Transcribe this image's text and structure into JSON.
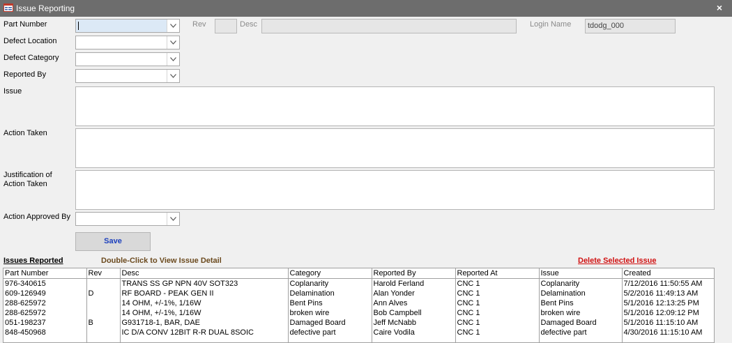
{
  "window": {
    "title": "Issue Reporting",
    "close_glyph": "×",
    "icon": "form-icon"
  },
  "fields": {
    "part_number_label": "Part Number",
    "rev_label": "Rev",
    "rev_value": "",
    "desc_label": "Desc",
    "desc_value": "",
    "login_name_label": "Login Name",
    "login_name_value": "tdodg_000",
    "defect_location_label": "Defect Location",
    "defect_category_label": "Defect Category",
    "reported_by_label": "Reported By",
    "issue_label": "Issue",
    "action_taken_label": "Action Taken",
    "justification_label_line1": "Justification of",
    "justification_label_line2": "Action Taken",
    "action_approved_by_label": "Action Approved By"
  },
  "buttons": {
    "save_label": "Save"
  },
  "issues_section": {
    "title": "Issues Reported",
    "hint": "Double-Click to View Issue Detail",
    "delete_label": "Delete Selected Issue"
  },
  "grid": {
    "columns": [
      "Part Number",
      "Rev",
      "Desc",
      "Category",
      "Reported By",
      "Reported At",
      "Issue",
      "Created"
    ],
    "rows": [
      [
        "976-340615",
        "",
        "TRANS SS GP NPN 40V SOT323",
        "Coplanarity",
        "Harold Ferland",
        "CNC 1",
        "Coplanarity",
        "7/12/2016 11:50:55 AM"
      ],
      [
        "609-126949",
        "D",
        "RF BOARD - PEAK GEN II",
        "Delamination",
        "Alan Yonder",
        "CNC 1",
        "Delamination",
        "5/2/2016 11:49:13 AM"
      ],
      [
        "288-625972",
        "",
        "14 OHM, +/-1%, 1/16W",
        "Bent Pins",
        "Ann Alves",
        "CNC 1",
        "Bent Pins",
        "5/1/2016 12:13:25 PM"
      ],
      [
        "288-625972",
        "",
        "14 OHM, +/-1%, 1/16W",
        "broken wire",
        "Bob Campbell",
        "CNC 1",
        "broken wire",
        "5/1/2016 12:09:12 PM"
      ],
      [
        "051-198237",
        "B",
        "G931718-1, BAR, DAE",
        "Damaged Board",
        "Jeff McNabb",
        "CNC 1",
        "Damaged Board",
        "5/1/2016 11:15:10 AM"
      ],
      [
        "848-450968",
        "",
        "IC D/A CONV 12BIT R-R DUAL 8SOIC",
        "defective part",
        "Caire Vodila",
        "CNC 1",
        "defective part",
        "4/30/2016 11:15:10 AM"
      ]
    ]
  },
  "colors": {
    "titlebar": "#6d6d6d",
    "save_text": "#1b3fbd",
    "delete_link": "#d01010",
    "hint_text": "#6b4a1e",
    "active_field": "#dce9f6"
  }
}
